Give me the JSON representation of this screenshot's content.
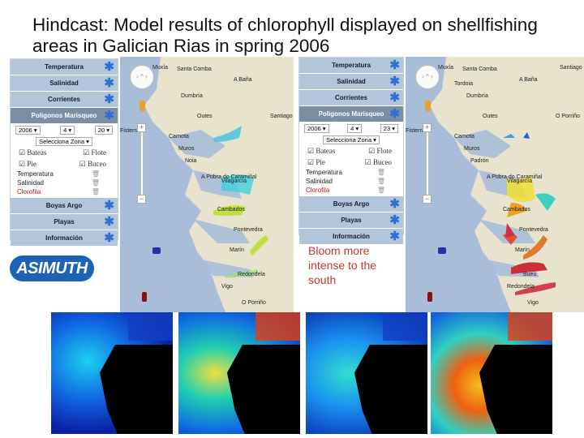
{
  "slide": {
    "title": "Hindcast: Model results of chlorophyll displayed on shellfishing areas in Galician Rias in spring 2006",
    "note": "Bloom more intense to the south",
    "logo": "ASIMUTH"
  },
  "colors": {
    "panel_item": "#b3c5da",
    "panel_selected": "#7b8ea6",
    "asterisk": "#2e6fd0",
    "note": "#c0392b",
    "sea": "#a9bdd8",
    "land": "#e7e3cd"
  },
  "panels": [
    {
      "menu_top": [
        "Temperatura",
        "Salinidad",
        "Corrientes"
      ],
      "selected": "Poligonos Marisqueo",
      "year": "2006",
      "month": "4",
      "day": "20",
      "zone": "Selecciona Zona",
      "checks": [
        "Bateas",
        "Flote",
        "Pie",
        "Buceo"
      ],
      "layers": [
        "Temperatura",
        "Salinidad",
        "Clorofila"
      ],
      "menu_bottom": [
        "Boyas Argo",
        "Playas",
        "Información"
      ]
    },
    {
      "menu_top": [
        "Temperatura",
        "Salinidad",
        "Corrientes"
      ],
      "selected": "Poligonos Marisqueo",
      "year": "2006",
      "month": "4",
      "day": "23",
      "zone": "Selecciona Zona",
      "checks": [
        "Bateas",
        "Flote",
        "Pie",
        "Buceo"
      ],
      "layers": [
        "Temperatura",
        "Salinidad",
        "Clorofila"
      ],
      "menu_bottom": [
        "Boyas Argo",
        "Playas",
        "Información"
      ]
    }
  ],
  "maps": [
    {
      "labels": [
        "Muxía",
        "Santa Comba",
        "Dumbría",
        "A Baña",
        "Fisterra",
        "Outes",
        "Carnota",
        "Muros",
        "Noia",
        "A Pobra do Caramiñal",
        "Vilagarcía",
        "Cambados",
        "Pontevedra",
        "Marín",
        "Redondela",
        "Vigo",
        "O Porriño",
        "Santiago de Compostela"
      ]
    },
    {
      "labels": [
        "Muxía",
        "Santa Comba",
        "Dumbría",
        "A Baña",
        "Fisterra",
        "Outes",
        "Carnota",
        "Muros",
        "Padrón",
        "A Pobra do Caramiñal",
        "Vilagarcía",
        "Cambados",
        "Pontevedra",
        "Marín",
        "Bueu",
        "Redondela",
        "Vigo",
        "O Porriño",
        "Santiago de Compostela",
        "Tordoia"
      ]
    }
  ],
  "map_controls": {
    "zoom_in": "+",
    "zoom_out": "−"
  }
}
